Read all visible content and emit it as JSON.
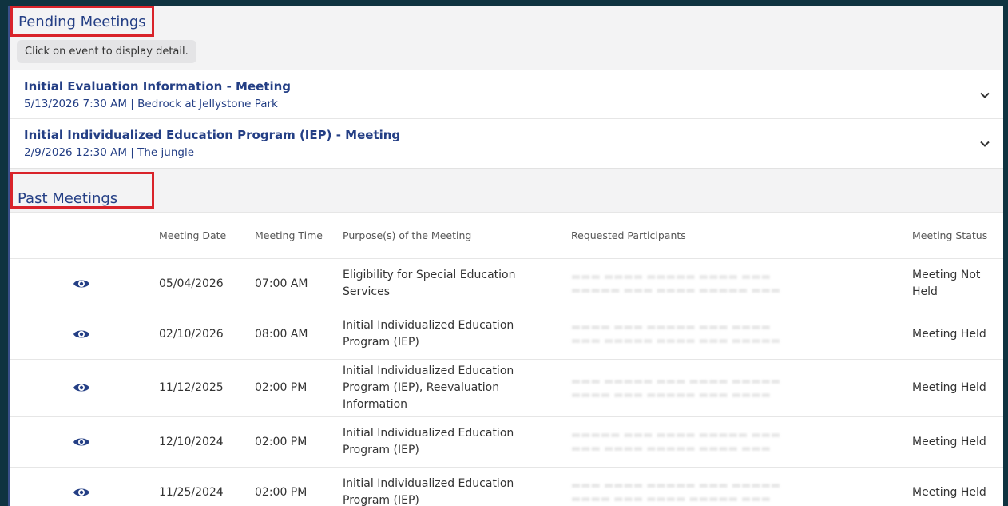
{
  "pending": {
    "title": "Pending Meetings",
    "hint": "Click on event to display detail.",
    "items": [
      {
        "title": "Initial Evaluation Information - Meeting",
        "subtitle": "5/13/2026 7:30 AM | Bedrock at Jellystone Park"
      },
      {
        "title": "Initial Individualized Education Program (IEP) - Meeting",
        "subtitle": "2/9/2026 12:30 AM | The jungle"
      }
    ]
  },
  "past": {
    "title": "Past Meetings",
    "columns": {
      "view": "",
      "date": "Meeting Date",
      "time": "Meeting Time",
      "purpose": "Purpose(s) of the Meeting",
      "participants": "Requested Participants",
      "status": "Meeting Status"
    },
    "rows": [
      {
        "date": "05/04/2026",
        "time": "07:00 AM",
        "purpose": "Eligibility for Special Education Services",
        "status": "Meeting Not Held"
      },
      {
        "date": "02/10/2026",
        "time": "08:00 AM",
        "purpose": "Initial Individualized Education Program (IEP)",
        "status": "Meeting Held"
      },
      {
        "date": "11/12/2025",
        "time": "02:00 PM",
        "purpose": "Initial Individualized Education Program (IEP), Reevaluation Information",
        "status": "Meeting Held"
      },
      {
        "date": "12/10/2024",
        "time": "02:00 PM",
        "purpose": "Initial Individualized Education Program (IEP)",
        "status": "Meeting Held"
      },
      {
        "date": "11/25/2024",
        "time": "02:00 PM",
        "purpose": "Initial Individualized Education Program (IEP)",
        "status": "Meeting Held"
      }
    ]
  },
  "colors": {
    "heading": "#243f85",
    "highlight": "#d9232a",
    "background": "#f3f3f4",
    "outer": "#0f3340"
  },
  "icons": {
    "view": "eye-icon",
    "expand": "chevron-down-icon"
  }
}
